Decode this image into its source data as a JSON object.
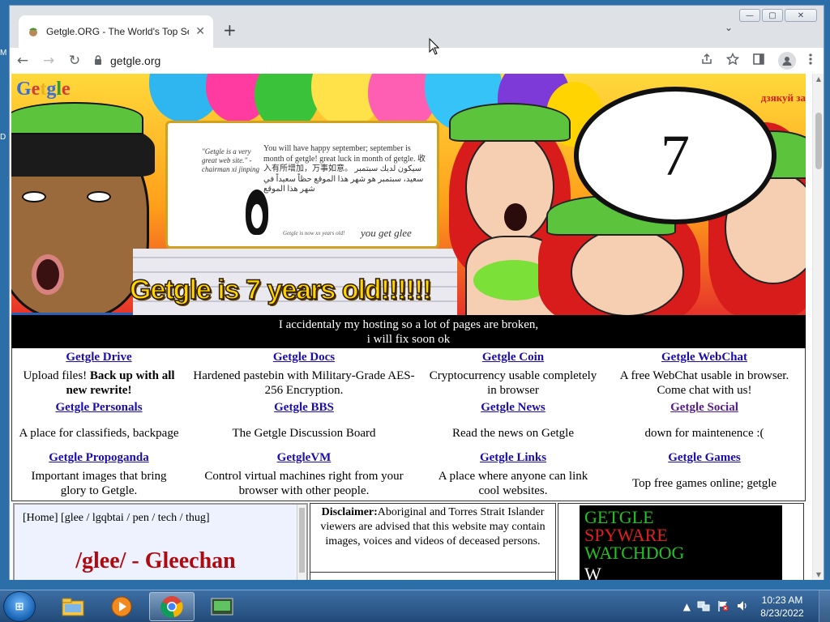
{
  "desktop": {
    "left_labels": [
      "M",
      "D"
    ]
  },
  "browser": {
    "tab_title": "Getgle.ORG - The World's Top Sear",
    "tab_close": "✕",
    "new_tab": "+",
    "tab_search": "⌄",
    "window_controls": {
      "minimize": "—",
      "maximize": "▢",
      "close": "✕"
    },
    "nav": {
      "back": "←",
      "forward": "→",
      "reload": "↻"
    },
    "url": "getgle.org",
    "toolbar_icons": [
      "share-icon",
      "star-icon",
      "sidebar-icon",
      "profile-icon",
      "menu-icon"
    ]
  },
  "banner": {
    "logo": "Getgle",
    "logo_colors": [
      "#3b6ed6",
      "#d63b3b",
      "#e8b020",
      "#3b6ed6",
      "#2d9b3a",
      "#d63b3b"
    ],
    "quote": "\"Getgle is a very great web site.\" - chairman xi jinping",
    "whiteboard_text": "You will have happy september; september is month of getgle! great luck in month of getgle. 收入有所增加，万事如意。 سيكون لديك سبتمبر سعيد، سبتمبر هو شهر هذا الموقع حظاً سعيداً في شهر هذا الموقع",
    "whiteboard_small": "Getgle is now xx years old!",
    "whiteboard_glee": "you get glee",
    "caption": "Getgle is 7 years old!!!!!!",
    "bubble_number": "7",
    "foreign_text": "дзякуй за"
  },
  "notice": {
    "line1": "I accidentaly my hosting so a lot of pages are broken,",
    "line2": "i will fix soon ok"
  },
  "services": [
    {
      "name": "Getgle Drive",
      "desc_pre": "Upload files! ",
      "desc_bold": "Back up with all new rewrite!",
      "visited": false
    },
    {
      "name": "Getgle Docs",
      "desc_pre": "Hardened pastebin with Military-Grade AES-256 Encryption.",
      "desc_bold": "",
      "visited": false
    },
    {
      "name": "Getgle Coin",
      "desc_pre": "Cryptocurrency usable completely in browser",
      "desc_bold": "",
      "visited": false
    },
    {
      "name": "Getgle WebChat",
      "desc_pre": "A free WebChat usable in browser. Come chat with us!",
      "desc_bold": "",
      "visited": false
    },
    {
      "name": "Getgle Personals",
      "desc_pre": "A place for classifieds, backpage",
      "desc_bold": "",
      "visited": false
    },
    {
      "name": "Getgle BBS",
      "desc_pre": "The Getgle Discussion Board",
      "desc_bold": "",
      "visited": false
    },
    {
      "name": "Getgle News",
      "desc_pre": "Read the news on Getgle",
      "desc_bold": "",
      "visited": false
    },
    {
      "name": "Getgle Social",
      "desc_pre": "down for maintenence :(",
      "desc_bold": "",
      "visited": true
    },
    {
      "name": "Getgle Propoganda",
      "desc_pre": "Important images that bring glory to Getgle.",
      "desc_bold": "",
      "visited": false
    },
    {
      "name": "GetgleVM",
      "desc_pre": "Control virtual machines right from your browser with other people.",
      "desc_bold": "",
      "visited": false
    },
    {
      "name": "Getgle Links",
      "desc_pre": "A place where anyone can link cool websites.",
      "desc_bold": "",
      "visited": false
    },
    {
      "name": "Getgle Games",
      "desc_pre": "Top free games online; getgle",
      "desc_bold": "",
      "visited": false
    }
  ],
  "chan": {
    "nav": "[Home] [glee / lgqbtai / pen / tech / thug]",
    "board_title": "/glee/ - Gleechan"
  },
  "disclaimer": {
    "label": "Disclaimer:",
    "text": "Aboriginal and Torres Strait Islander viewers are advised that this website may contain images, voices and videos of deceased persons."
  },
  "ad": {
    "line1": "GETGLE",
    "line2": "SPYWARE",
    "line3": "WATCHDOG",
    "line4": "W"
  },
  "taskbar": {
    "start_label": "⊞",
    "items": [
      "explorer-icon",
      "media-player-icon",
      "chrome-icon",
      "terminal-icon"
    ],
    "tray_icons": [
      "▲",
      "network-icon",
      "flag-icon",
      "volume-icon"
    ],
    "time": "10:23 AM",
    "date": "8/23/2022"
  }
}
